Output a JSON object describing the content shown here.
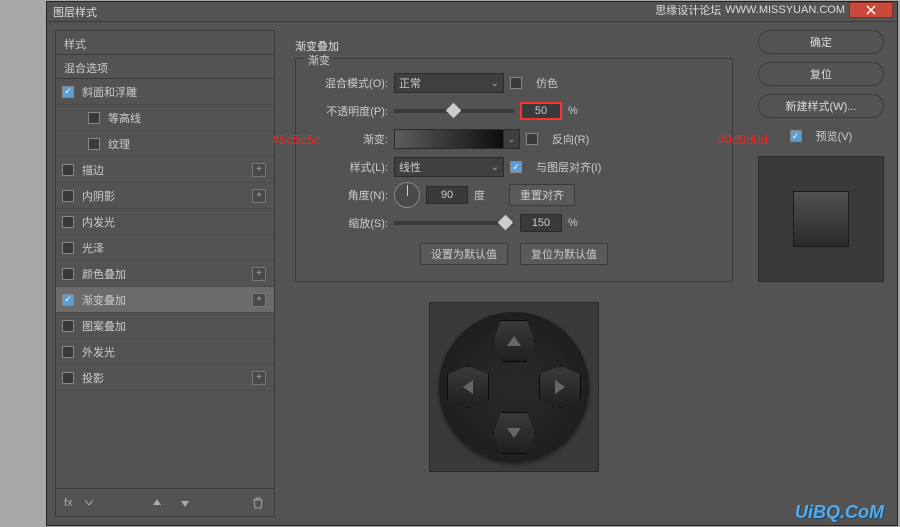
{
  "dialog": {
    "title": "图层样式"
  },
  "titlebar": {
    "watermark1": "思缘设计论坛",
    "watermark2": "WWW.MISSYUAN.COM"
  },
  "left": {
    "header1": "样式",
    "header2": "混合选项",
    "items": [
      {
        "label": "斜面和浮雕",
        "checked": true,
        "plus": false,
        "indent": false
      },
      {
        "label": "等高线",
        "checked": false,
        "plus": false,
        "indent": true
      },
      {
        "label": "纹理",
        "checked": false,
        "plus": false,
        "indent": true
      },
      {
        "label": "描边",
        "checked": false,
        "plus": true,
        "indent": false
      },
      {
        "label": "内阴影",
        "checked": false,
        "plus": true,
        "indent": false
      },
      {
        "label": "内发光",
        "checked": false,
        "plus": false,
        "indent": false
      },
      {
        "label": "光泽",
        "checked": false,
        "plus": false,
        "indent": false
      },
      {
        "label": "颜色叠加",
        "checked": false,
        "plus": true,
        "indent": false
      },
      {
        "label": "渐变叠加",
        "checked": true,
        "plus": true,
        "indent": false,
        "selected": true
      },
      {
        "label": "图案叠加",
        "checked": false,
        "plus": false,
        "indent": false
      },
      {
        "label": "外发光",
        "checked": false,
        "plus": false,
        "indent": false
      },
      {
        "label": "投影",
        "checked": false,
        "plus": true,
        "indent": false
      }
    ],
    "footer_fx": "fx"
  },
  "center": {
    "section_title": "渐变叠加",
    "box_title": "渐变",
    "blend_mode_label": "混合模式(O):",
    "blend_mode_value": "正常",
    "dither_label": "仿色",
    "opacity_label": "不透明度(P):",
    "opacity_value": "50",
    "opacity_unit": "%",
    "gradient_label": "渐变:",
    "reverse_label": "反向(R)",
    "style_label": "样式(L):",
    "style_value": "线性",
    "align_label": "与图层对齐(I)",
    "angle_label": "角度(N):",
    "angle_value": "90",
    "angle_unit": "度",
    "reset_align": "重置对齐",
    "scale_label": "缩放(S):",
    "scale_value": "150",
    "scale_unit": "%",
    "set_default": "设置为默认值",
    "reset_default": "复位为默认值"
  },
  "annotations": {
    "color1": "#5c5c5c",
    "color2": "#0d0d0d"
  },
  "right": {
    "ok": "确定",
    "cancel": "复位",
    "new_style": "新建样式(W)...",
    "preview": "预览(V)"
  },
  "bottom_watermark": "UiBQ.CoM"
}
